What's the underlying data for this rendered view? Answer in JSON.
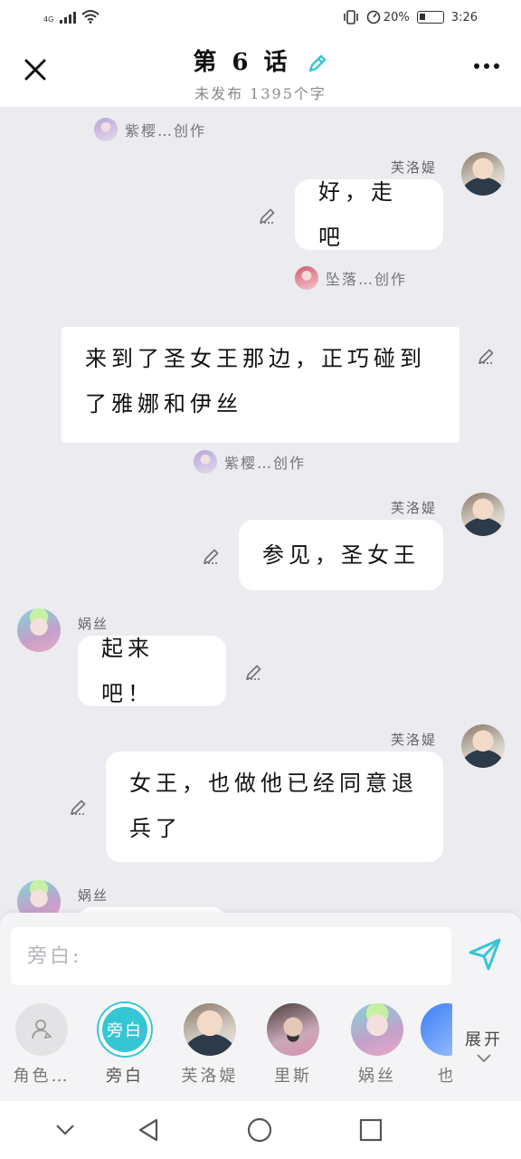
{
  "status_bar": {
    "network": "4G",
    "battery": "20%",
    "time": "3:26"
  },
  "header": {
    "title": "第 6 话",
    "subtitle": "未发布 1395个字"
  },
  "chat": {
    "creators": [
      {
        "name": "紫樱…创作"
      },
      {
        "name": "坠落…创作"
      },
      {
        "name": "紫樱…创作"
      }
    ],
    "messages": [
      {
        "speaker": "芙洛媞",
        "text": "好，走吧"
      },
      {
        "speaker": "",
        "text": "来到了圣女王那边，正巧碰到了雅娜和伊丝"
      },
      {
        "speaker": "芙洛媞",
        "text": "参见，圣女王"
      },
      {
        "speaker": "娲丝",
        "text": "起来吧！"
      },
      {
        "speaker": "芙洛媞",
        "text": "女王，也做他已经同意退兵了"
      },
      {
        "speaker": "娲丝",
        "text": ""
      }
    ]
  },
  "input": {
    "placeholder": "旁白:"
  },
  "roles": [
    {
      "label": "角色…",
      "icon": "add-role-icon"
    },
    {
      "label": "旁白",
      "badge": "旁白"
    },
    {
      "label": "芙洛媞"
    },
    {
      "label": "里斯"
    },
    {
      "label": "娲丝"
    },
    {
      "label": "也"
    }
  ],
  "expand_label": "展开",
  "colors": {
    "accent": "#35c6d3",
    "bubble": "#ffffff",
    "background": "#ebebf0"
  }
}
